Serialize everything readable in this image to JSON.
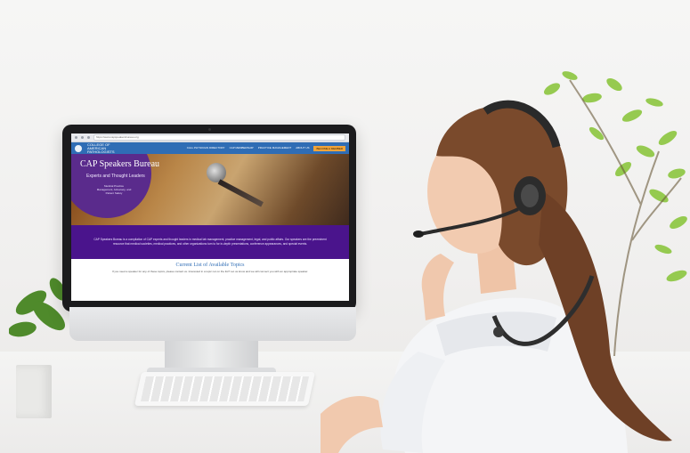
{
  "website": {
    "browser_url": "https://www.capspeakersbureau.org",
    "logo_text": "COLLEGE OF AMERICAN PATHOLOGISTS",
    "nav_links": [
      "CALL PHYSICIAN DIRECTORY",
      "CAP MEMBERSHIP",
      "PRACTICE MANAGEMENT",
      "ABOUT US"
    ],
    "nav_button": "BECOME A MEMBER",
    "hero": {
      "title": "CAP Speakers Bureau",
      "subtitle": "Experts and Thought Leaders",
      "small_text": "Medical Practice Management, Advocacy, and Patient Safety"
    },
    "description": "CAP Speakers Bureau is a compilation of CAP experts and thought leaders in medical lab management, practice management, legal, and public affairs. Our speakers are the preeminent resource that medical societies, medical practices, and other organizations turn to for in-depth presentations, conference appearances, and special events.",
    "topics": {
      "title": "Current List of Available Topics",
      "text": "If you need a speaker for any of these topics, please contact us. Interested in a topic not on the list? Let us know and we will connect you with an appropriate speaker."
    }
  },
  "colors": {
    "nav_blue": "#2f6db5",
    "purple": "#4a148c",
    "orange": "#f0a43a"
  }
}
